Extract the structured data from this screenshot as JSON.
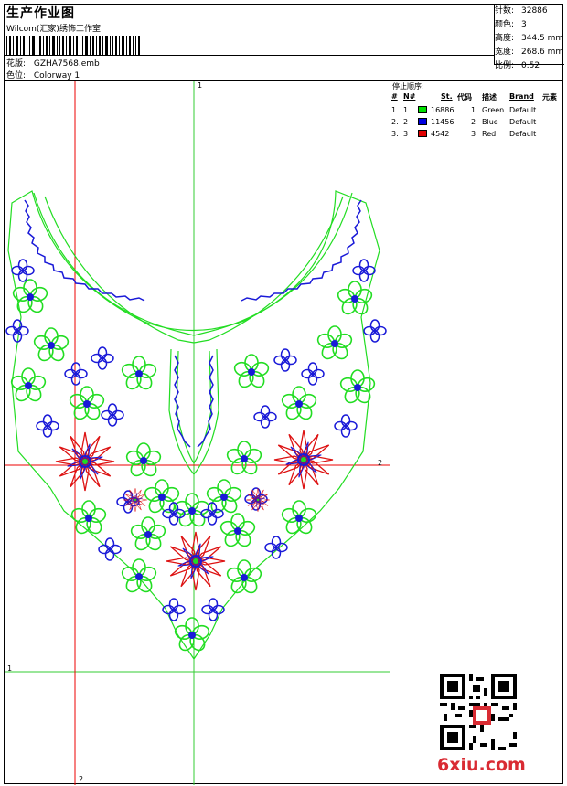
{
  "header": {
    "title": "生产作业图",
    "company": "Wilcom(汇家)绣饰工作室",
    "pattern_label": "花版:",
    "pattern_value": "GZHA7568.emb",
    "colorway_label": "色位:",
    "colorway_value": "Colorway 1"
  },
  "stats": {
    "stitches_label": "针数:",
    "stitches_value": "32886",
    "colors_label": "颜色:",
    "colors_value": "3",
    "height_label": "高度:",
    "height_value": "344.5 mm",
    "width_label": "宽度:",
    "width_value": "268.6 mm",
    "scale_label": "比例:",
    "scale_value": "0.52"
  },
  "color_table": {
    "caption": "停止顺序:",
    "headers": [
      "#",
      "N#",
      "St.",
      "代码",
      "描述",
      "Brand",
      "元素"
    ],
    "rows": [
      {
        "idx": "1.",
        "n": "1",
        "color": "#00e000",
        "st": "16886",
        "code": "1",
        "desc": "Green",
        "brand": "Default"
      },
      {
        "idx": "2.",
        "n": "2",
        "color": "#0000e0",
        "st": "11456",
        "code": "2",
        "desc": "Blue",
        "brand": "Default"
      },
      {
        "idx": "3.",
        "n": "3",
        "color": "#e00000",
        "st": "4542",
        "code": "3",
        "desc": "Red",
        "brand": "Default"
      }
    ]
  },
  "guides": {
    "v1": "1",
    "h2": "2",
    "h1": "1",
    "v2": "2"
  },
  "colors": {
    "green": "#22dd22",
    "blue": "#1a1ad8",
    "red": "#dd1111",
    "guide_green": "#33cc33",
    "guide_red": "#ee0000"
  },
  "watermark": "6xiu.com"
}
